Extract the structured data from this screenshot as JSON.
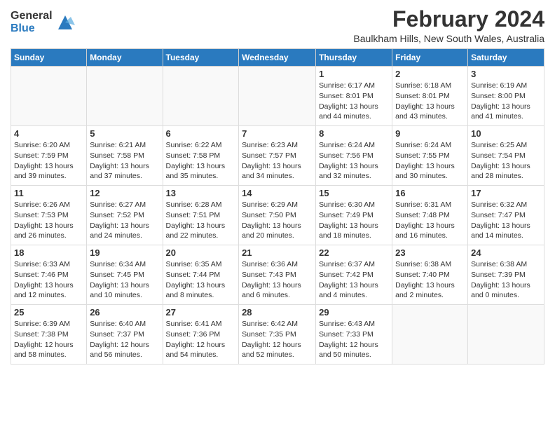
{
  "header": {
    "logo_general": "General",
    "logo_blue": "Blue",
    "month_year": "February 2024",
    "location": "Baulkham Hills, New South Wales, Australia"
  },
  "days_of_week": [
    "Sunday",
    "Monday",
    "Tuesday",
    "Wednesday",
    "Thursday",
    "Friday",
    "Saturday"
  ],
  "weeks": [
    [
      {
        "day": "",
        "info": ""
      },
      {
        "day": "",
        "info": ""
      },
      {
        "day": "",
        "info": ""
      },
      {
        "day": "",
        "info": ""
      },
      {
        "day": "1",
        "info": "Sunrise: 6:17 AM\nSunset: 8:01 PM\nDaylight: 13 hours\nand 44 minutes."
      },
      {
        "day": "2",
        "info": "Sunrise: 6:18 AM\nSunset: 8:01 PM\nDaylight: 13 hours\nand 43 minutes."
      },
      {
        "day": "3",
        "info": "Sunrise: 6:19 AM\nSunset: 8:00 PM\nDaylight: 13 hours\nand 41 minutes."
      }
    ],
    [
      {
        "day": "4",
        "info": "Sunrise: 6:20 AM\nSunset: 7:59 PM\nDaylight: 13 hours\nand 39 minutes."
      },
      {
        "day": "5",
        "info": "Sunrise: 6:21 AM\nSunset: 7:58 PM\nDaylight: 13 hours\nand 37 minutes."
      },
      {
        "day": "6",
        "info": "Sunrise: 6:22 AM\nSunset: 7:58 PM\nDaylight: 13 hours\nand 35 minutes."
      },
      {
        "day": "7",
        "info": "Sunrise: 6:23 AM\nSunset: 7:57 PM\nDaylight: 13 hours\nand 34 minutes."
      },
      {
        "day": "8",
        "info": "Sunrise: 6:24 AM\nSunset: 7:56 PM\nDaylight: 13 hours\nand 32 minutes."
      },
      {
        "day": "9",
        "info": "Sunrise: 6:24 AM\nSunset: 7:55 PM\nDaylight: 13 hours\nand 30 minutes."
      },
      {
        "day": "10",
        "info": "Sunrise: 6:25 AM\nSunset: 7:54 PM\nDaylight: 13 hours\nand 28 minutes."
      }
    ],
    [
      {
        "day": "11",
        "info": "Sunrise: 6:26 AM\nSunset: 7:53 PM\nDaylight: 13 hours\nand 26 minutes."
      },
      {
        "day": "12",
        "info": "Sunrise: 6:27 AM\nSunset: 7:52 PM\nDaylight: 13 hours\nand 24 minutes."
      },
      {
        "day": "13",
        "info": "Sunrise: 6:28 AM\nSunset: 7:51 PM\nDaylight: 13 hours\nand 22 minutes."
      },
      {
        "day": "14",
        "info": "Sunrise: 6:29 AM\nSunset: 7:50 PM\nDaylight: 13 hours\nand 20 minutes."
      },
      {
        "day": "15",
        "info": "Sunrise: 6:30 AM\nSunset: 7:49 PM\nDaylight: 13 hours\nand 18 minutes."
      },
      {
        "day": "16",
        "info": "Sunrise: 6:31 AM\nSunset: 7:48 PM\nDaylight: 13 hours\nand 16 minutes."
      },
      {
        "day": "17",
        "info": "Sunrise: 6:32 AM\nSunset: 7:47 PM\nDaylight: 13 hours\nand 14 minutes."
      }
    ],
    [
      {
        "day": "18",
        "info": "Sunrise: 6:33 AM\nSunset: 7:46 PM\nDaylight: 13 hours\nand 12 minutes."
      },
      {
        "day": "19",
        "info": "Sunrise: 6:34 AM\nSunset: 7:45 PM\nDaylight: 13 hours\nand 10 minutes."
      },
      {
        "day": "20",
        "info": "Sunrise: 6:35 AM\nSunset: 7:44 PM\nDaylight: 13 hours\nand 8 minutes."
      },
      {
        "day": "21",
        "info": "Sunrise: 6:36 AM\nSunset: 7:43 PM\nDaylight: 13 hours\nand 6 minutes."
      },
      {
        "day": "22",
        "info": "Sunrise: 6:37 AM\nSunset: 7:42 PM\nDaylight: 13 hours\nand 4 minutes."
      },
      {
        "day": "23",
        "info": "Sunrise: 6:38 AM\nSunset: 7:40 PM\nDaylight: 13 hours\nand 2 minutes."
      },
      {
        "day": "24",
        "info": "Sunrise: 6:38 AM\nSunset: 7:39 PM\nDaylight: 13 hours\nand 0 minutes."
      }
    ],
    [
      {
        "day": "25",
        "info": "Sunrise: 6:39 AM\nSunset: 7:38 PM\nDaylight: 12 hours\nand 58 minutes."
      },
      {
        "day": "26",
        "info": "Sunrise: 6:40 AM\nSunset: 7:37 PM\nDaylight: 12 hours\nand 56 minutes."
      },
      {
        "day": "27",
        "info": "Sunrise: 6:41 AM\nSunset: 7:36 PM\nDaylight: 12 hours\nand 54 minutes."
      },
      {
        "day": "28",
        "info": "Sunrise: 6:42 AM\nSunset: 7:35 PM\nDaylight: 12 hours\nand 52 minutes."
      },
      {
        "day": "29",
        "info": "Sunrise: 6:43 AM\nSunset: 7:33 PM\nDaylight: 12 hours\nand 50 minutes."
      },
      {
        "day": "",
        "info": ""
      },
      {
        "day": "",
        "info": ""
      }
    ]
  ]
}
